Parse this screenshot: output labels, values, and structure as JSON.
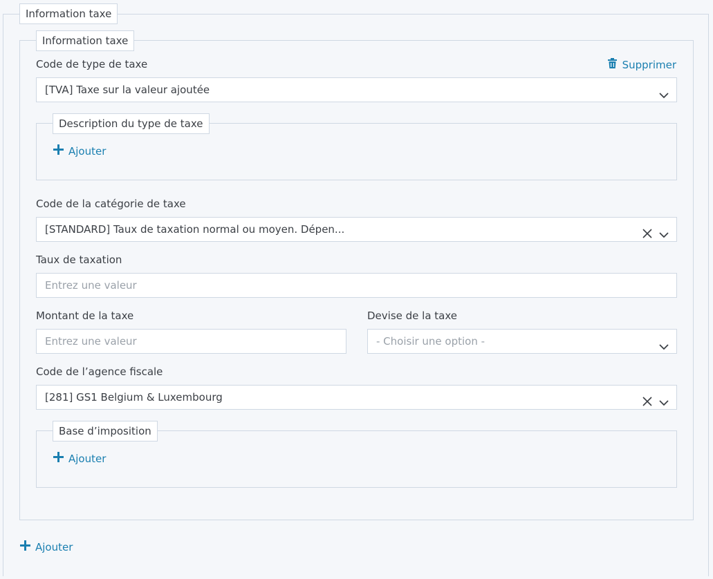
{
  "outer": {
    "legend": "Information taxe",
    "add_label": "Ajouter"
  },
  "inner": {
    "legend": "Information taxe",
    "delete_label": "Supprimer",
    "tax_type_code": {
      "label": "Code de type de taxe",
      "value": "[TVA] Taxe sur la valeur ajoutée"
    },
    "tax_type_description": {
      "legend": "Description du type de taxe",
      "add_label": "Ajouter"
    },
    "tax_category_code": {
      "label": "Code de la catégorie de taxe",
      "value": "[STANDARD] Taux de taxation normal ou moyen. Dépen..."
    },
    "tax_rate": {
      "label": "Taux de taxation",
      "placeholder": "Entrez une valeur"
    },
    "tax_amount": {
      "label": "Montant de la taxe",
      "placeholder": "Entrez une valeur"
    },
    "tax_currency": {
      "label": "Devise de la taxe",
      "placeholder": "- Choisir une option -"
    },
    "tax_agency_code": {
      "label": "Code de l’agence fiscale",
      "value": "[281] GS1 Belgium & Luxembourg"
    },
    "tax_base": {
      "legend": "Base d’imposition",
      "add_label": "Ajouter"
    }
  },
  "colors": {
    "accent": "#1a7fb0",
    "border": "#cfd8e3",
    "background": "#f5f7fa"
  },
  "icons": {
    "chevron": "chevron-down-icon",
    "clear": "close-icon",
    "add": "plus-icon",
    "delete": "trash-icon"
  }
}
